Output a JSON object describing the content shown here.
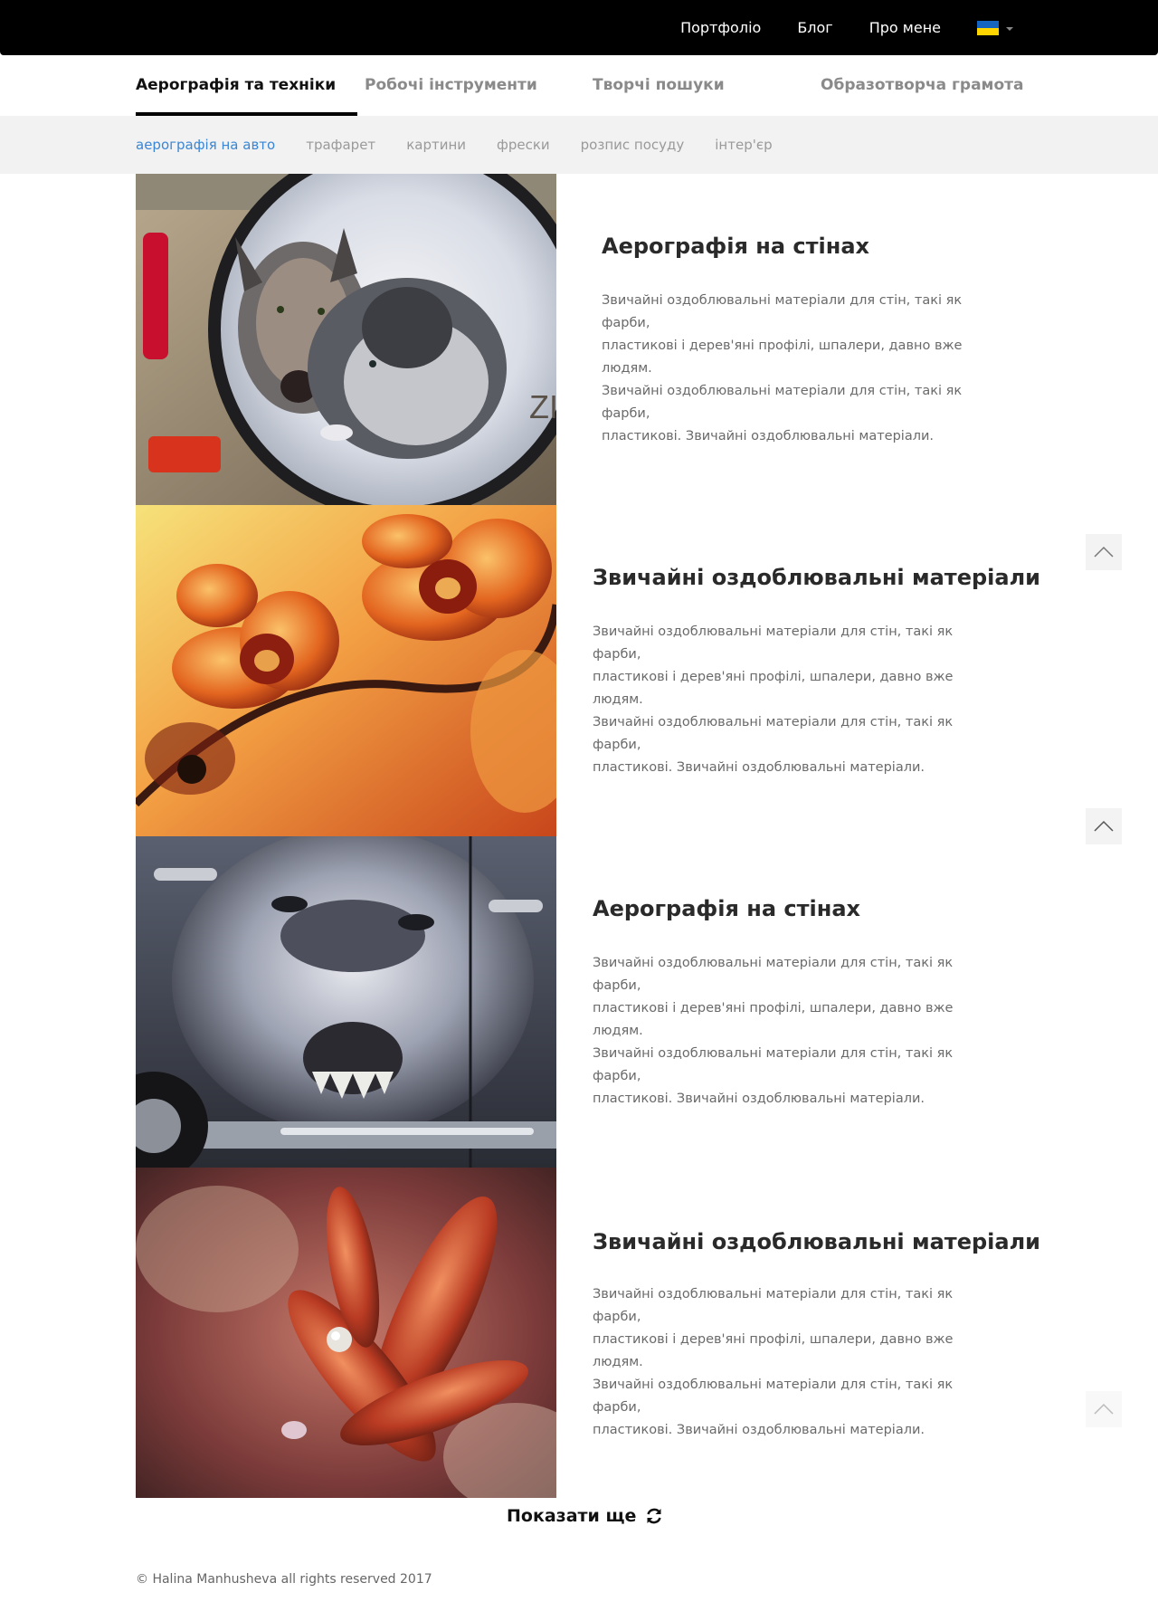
{
  "topnav": {
    "items": [
      {
        "label": "Портфоліо"
      },
      {
        "label": "Блог"
      },
      {
        "label": "Про мене"
      }
    ],
    "language": {
      "icon": "ukraine-flag-icon",
      "flag_colors": [
        "#1565C0",
        "#FFD500"
      ]
    }
  },
  "tabs": [
    {
      "label": "Аерографія та техніки",
      "active": true
    },
    {
      "label": "Робочі інструменти",
      "active": false
    },
    {
      "label": "Творчі пошуки",
      "active": false
    },
    {
      "label": "Образотворча грамота",
      "active": false
    }
  ],
  "subtabs": [
    {
      "label": "аерографія на авто",
      "active": true
    },
    {
      "label": "трафарет",
      "active": false
    },
    {
      "label": "картини",
      "active": false
    },
    {
      "label": "фрески",
      "active": false
    },
    {
      "label": "розпис посуду",
      "active": false
    },
    {
      "label": "інтер'єр",
      "active": false
    }
  ],
  "articles": [
    {
      "image": "wolves-spare-tire-airbrush",
      "title": "Аерографія на стінах",
      "lines": [
        "Звичайні оздоблювальні матеріали для стін, такі як фарби,",
        "пластикові і дерев'яні профілі, шпалери, давно вже людям.",
        "Звичайні оздоблювальні матеріали для стін, такі як фарби,",
        "пластикові. Звичайні оздоблювальні матеріали."
      ]
    },
    {
      "image": "orange-orchids-airbrush",
      "title": "Звичайні оздоблювальні матеріали",
      "lines": [
        "Звичайні оздоблювальні матеріали для стін, такі як фарби,",
        "пластикові і дерев'яні профілі, шпалери, давно вже людям.",
        "Звичайні оздоблювальні матеріали для стін, такі як фарби,",
        "пластикові. Звичайні оздоблювальні матеріали."
      ]
    },
    {
      "image": "wolf-car-door-airbrush",
      "title": "Аерографія на стінах",
      "lines": [
        "Звичайні оздоблювальні матеріали для стін, такі як фарби,",
        "пластикові і дерев'яні профілі, шпалери, давно вже людям.",
        "Звичайні оздоблювальні матеріали для стін, такі як фарби,",
        "пластикові. Звичайні оздоблювальні матеріали."
      ]
    },
    {
      "image": "red-flower-dewdrops-airbrush",
      "title": "Звичайні оздоблювальні матеріали",
      "lines": [
        "Звичайні оздоблювальні матеріали для стін, такі як фарби,",
        "пластикові і дерев'яні профілі, шпалери, давно вже людям.",
        "Звичайні оздоблювальні матеріали для стін, такі як фарби,",
        "пластикові. Звичайні оздоблювальні матеріали."
      ]
    }
  ],
  "scroll_top": {
    "icon": "chevron-up-icon"
  },
  "load_more": {
    "label": "Показати ще",
    "icon": "refresh-icon"
  },
  "footer": {
    "text": "© Halina Manhusheva all rights reserved 2017"
  },
  "colors": {
    "accent": "#3a86d4",
    "topbar": "#000000",
    "subbar": "#f2f2f2"
  }
}
